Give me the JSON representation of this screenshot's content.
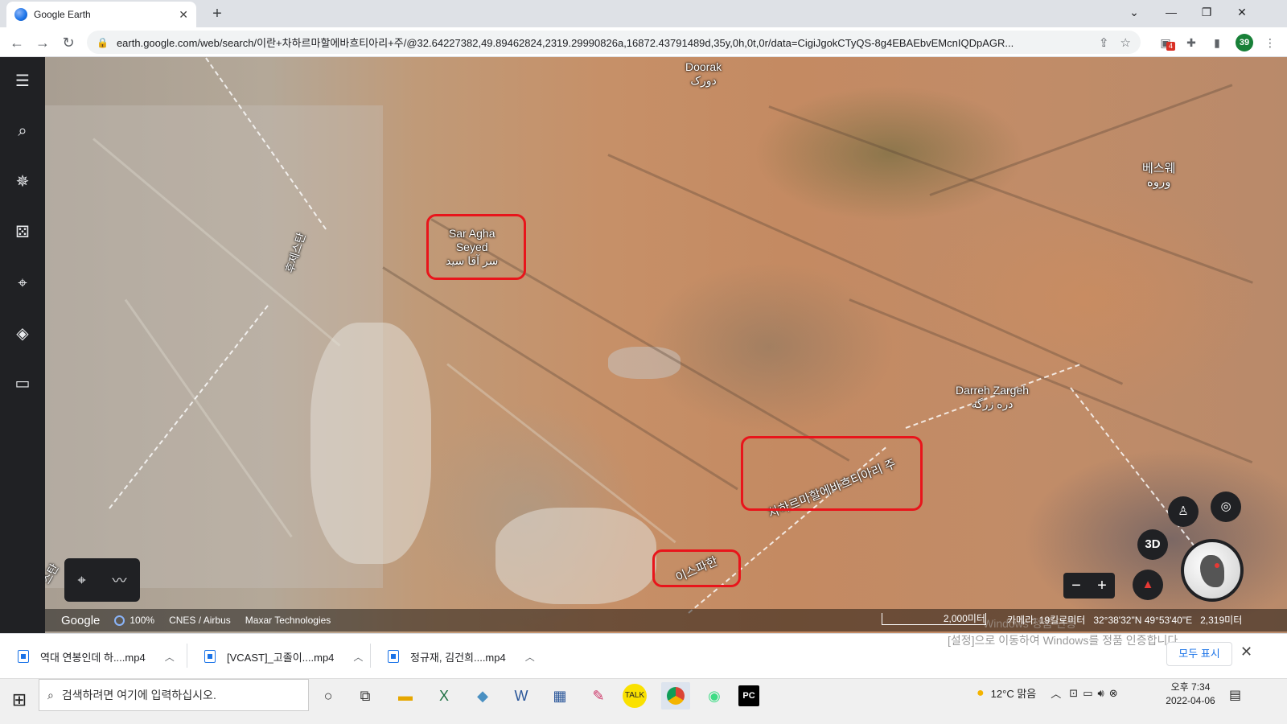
{
  "browser": {
    "tab_title": "Google Earth",
    "new_tab_label": "+",
    "url": "earth.google.com/web/search/이란+차하르마할에바흐티아리+주/@32.64227382,49.89462824,2319.29990826a,16872.43791489d,35y,0h,0t,0r/data=CigiJgokCTyQS-8g4EBAEbvEMcnIQDpAGR...",
    "profile_number": "39",
    "ext_badge": "4",
    "window_controls": [
      "⌄",
      "—",
      "❐",
      "✕"
    ]
  },
  "rail": {
    "items": [
      "menu-icon",
      "search-icon",
      "voyager-icon",
      "feeling-lucky-icon",
      "projects-icon",
      "map-style-icon",
      "measure-icon"
    ]
  },
  "map": {
    "labels": {
      "doorak": "Doorak",
      "doorak_fa": "دورک",
      "sar_agha_1": "Sar Agha",
      "sar_agha_2": "Seyed",
      "sar_agha_fa": "سر آقا سید",
      "beswe": "베스웨",
      "beswe_fa": "وروه",
      "darreh": "Darreh Zargeh",
      "darreh_fa": "دره زرگه",
      "chaharmahal": "차하르마할에바흐티아리 주",
      "isfahan": "이스파한",
      "left_region": "후제스탄",
      "left_edge": "스탄"
    },
    "controls": {
      "three_d": "3D",
      "zoom_out": "−",
      "zoom_in": "+"
    }
  },
  "status_bar": {
    "brand": "Google",
    "percent": "100%",
    "credits_1": "CNES / Airbus",
    "credits_2": "Maxar Technologies",
    "scale": "2,000미터",
    "camera": "카메라: 19킬로미터",
    "coords": "32°38'32\"N 49°53'40\"E",
    "elevation": "2,319미터",
    "windows_watermark": "[설정]으로 이동하여 Windows를 정품 인증합니다.",
    "windows_watermark_top": "Windows 정품 인증"
  },
  "downloads": {
    "items": [
      "역대 연봉인데 하....mp4",
      "[VCAST]_고졸이....mp4",
      "정규재, 김건희....mp4"
    ],
    "show_all": "모두 표시"
  },
  "taskbar": {
    "search_placeholder": "검색하려면 여기에 입력하십시오.",
    "weather": "12°C  맑음",
    "time": "오후 7:34",
    "date": "2022-04-06",
    "apps": [
      "task-view-icon",
      "file-explorer-icon",
      "excel-icon",
      "app-icon",
      "word-icon",
      "calendar-icon",
      "paint-icon",
      "kakaotalk-icon",
      "chrome-icon",
      "android-icon",
      "pycharm-icon"
    ]
  }
}
